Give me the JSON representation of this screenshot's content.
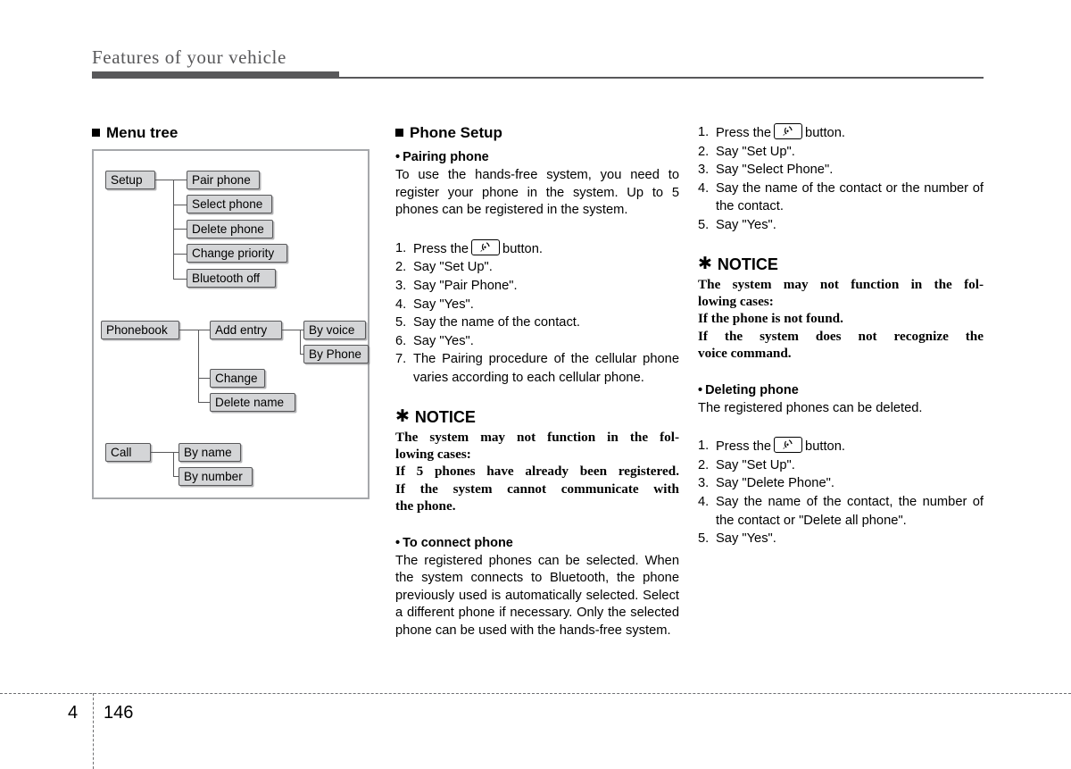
{
  "header": {
    "title": "Features of your vehicle"
  },
  "footer": {
    "chapter": "4",
    "page": "146"
  },
  "left_column": {
    "heading": "Menu tree",
    "menu_tree": {
      "branches": [
        {
          "root": "Setup",
          "children": [
            {
              "label": "Pair phone"
            },
            {
              "label": "Select phone"
            },
            {
              "label": "Delete phone"
            },
            {
              "label": "Change priority"
            },
            {
              "label": "Bluetooth off"
            }
          ]
        },
        {
          "root": "Phonebook",
          "children": [
            {
              "label": "Add entry",
              "children": [
                {
                  "label": "By voice"
                },
                {
                  "label": "By Phone"
                }
              ]
            },
            {
              "label": "Change"
            },
            {
              "label": "Delete name"
            }
          ]
        },
        {
          "root": "Call",
          "children": [
            {
              "label": "By name"
            },
            {
              "label": "By number"
            }
          ]
        }
      ]
    }
  },
  "middle_column": {
    "heading": "Phone Setup",
    "pairing": {
      "subheading": "Pairing phone",
      "bullet": "•",
      "body": "To use the hands-free system, you need to register your phone in the system. Up to 5 phones can be registered in the system.",
      "steps": [
        {
          "num": "1.",
          "text_before": "Press the",
          "icon": "phone-button-icon",
          "text_after": "button."
        },
        {
          "num": "2.",
          "text": "Say \"Set Up\"."
        },
        {
          "num": "3.",
          "text": "Say \"Pair Phone\"."
        },
        {
          "num": "4.",
          "text": "Say \"Yes\"."
        },
        {
          "num": "5.",
          "text": "Say the name of the contact."
        },
        {
          "num": "6.",
          "text": "Say \"Yes\"."
        },
        {
          "num": "7.",
          "text": "The Pairing procedure of the cellular phone varies according to each cellular phone."
        }
      ]
    },
    "notice": {
      "star": "✱",
      "title": "NOTICE",
      "lines": [
        "The system may not function in the fol-",
        "lowing cases:",
        "If 5 phones have already been registered.",
        "If the system cannot communicate with",
        "the phone."
      ]
    },
    "connect": {
      "subheading": "To connect phone",
      "bullet": "•",
      "body": "The registered phones can be selected. When the system connects to Bluetooth, the phone previously used is automatically selected. Select a different phone if necessary. Only the selected phone can be used with the hands-free system."
    }
  },
  "right_column": {
    "select_steps": [
      {
        "num": "1.",
        "text_before": "Press the",
        "icon": "phone-button-icon",
        "text_after": "button."
      },
      {
        "num": "2.",
        "text": "Say \"Set Up\"."
      },
      {
        "num": "3.",
        "text": "Say \"Select Phone\"."
      },
      {
        "num": "4.",
        "text": "Say the name of the contact or the number of the contact."
      },
      {
        "num": "5.",
        "text": "Say \"Yes\"."
      }
    ],
    "notice": {
      "star": "✱",
      "title": "NOTICE",
      "lines": [
        "The system may not function in the fol-",
        "lowing cases:",
        "If the phone is not found.",
        "If the system does not recognize the",
        "voice command."
      ]
    },
    "deleting": {
      "subheading": "Deleting phone",
      "bullet": "•",
      "body": "The registered phones can be deleted.",
      "steps": [
        {
          "num": "1.",
          "text_before": "Press the",
          "icon": "phone-button-icon",
          "text_after": "button."
        },
        {
          "num": "2.",
          "text": "Say \"Set Up\"."
        },
        {
          "num": "3.",
          "text": "Say \"Delete Phone\"."
        },
        {
          "num": "4.",
          "text": "Say the name of the contact, the number of the contact  or \"Delete all phone\"."
        },
        {
          "num": "5.",
          "text": "Say \"Yes\"."
        }
      ]
    }
  },
  "colors": {
    "header_rule": "#58585a",
    "node_fill": "#d4d5d7",
    "node_border": "#58585a",
    "box_border": "#a6a8ab"
  }
}
